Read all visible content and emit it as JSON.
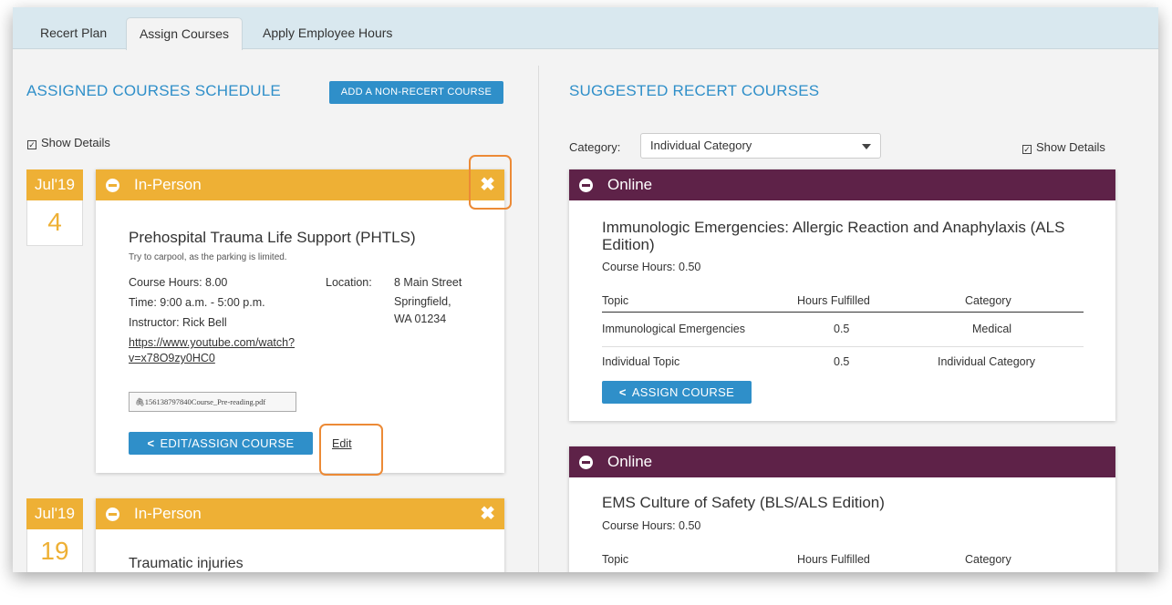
{
  "tabs": [
    {
      "label": "Recert Plan"
    },
    {
      "label": "Assign Courses"
    },
    {
      "label": "Apply Employee Hours"
    }
  ],
  "left": {
    "title": "ASSIGNED COURSES SCHEDULE",
    "add_button": "ADD A NON-RECERT COURSE",
    "show_details": "Show Details",
    "courses": [
      {
        "month": "Jul'19",
        "day": "4",
        "type": "In-Person",
        "title": "Prehospital Trauma Life Support (PHTLS)",
        "note": "Try to carpool, as the parking is limited.",
        "hours": "Course Hours: 8.00",
        "time": "Time: 9:00 a.m. - 5:00 p.m.",
        "instructor": "Instructor: Rick Bell",
        "location_label": "Location:",
        "location_line1": "8 Main Street",
        "location_line2": "Springfield,",
        "location_line3": "WA 01234",
        "link_line1": "https://www.youtube.com/watch?",
        "link_line2": "v=x78O9zy0HC0",
        "attachment": "156138797840Course_Pre-reading.pdf",
        "edit_assign_button": "EDIT/ASSIGN COURSE",
        "edit_link": "Edit"
      },
      {
        "month": "Jul'19",
        "day": "19",
        "type": "In-Person",
        "title": "Traumatic injuries"
      }
    ]
  },
  "right": {
    "title": "SUGGESTED RECERT COURSES",
    "category_label": "Category:",
    "category_value": "Individual Category",
    "show_details": "Show Details",
    "columns": [
      "Topic",
      "Hours Fulfilled",
      "Category"
    ],
    "courses": [
      {
        "type": "Online",
        "title_line1": "Immunologic Emergencies: Allergic Reaction and Anaphylaxis (ALS",
        "title_line2": "Edition)",
        "hours": "Course Hours: 0.50",
        "rows": [
          {
            "topic": "Immunological Emergencies",
            "hours": "0.5",
            "category": "Medical"
          },
          {
            "topic": "Individual Topic",
            "hours": "0.5",
            "category": "Individual Category"
          }
        ],
        "assign_button": "ASSIGN COURSE"
      },
      {
        "type": "Online",
        "title_line1": "EMS Culture of Safety (BLS/ALS Edition)",
        "hours": "Course Hours: 0.50"
      }
    ]
  },
  "colors": {
    "accent_blue": "#2f8fc9",
    "in_person_orange": "#eeb035",
    "online_purple": "#5e2248",
    "highlight_orange": "#ec8a36"
  }
}
